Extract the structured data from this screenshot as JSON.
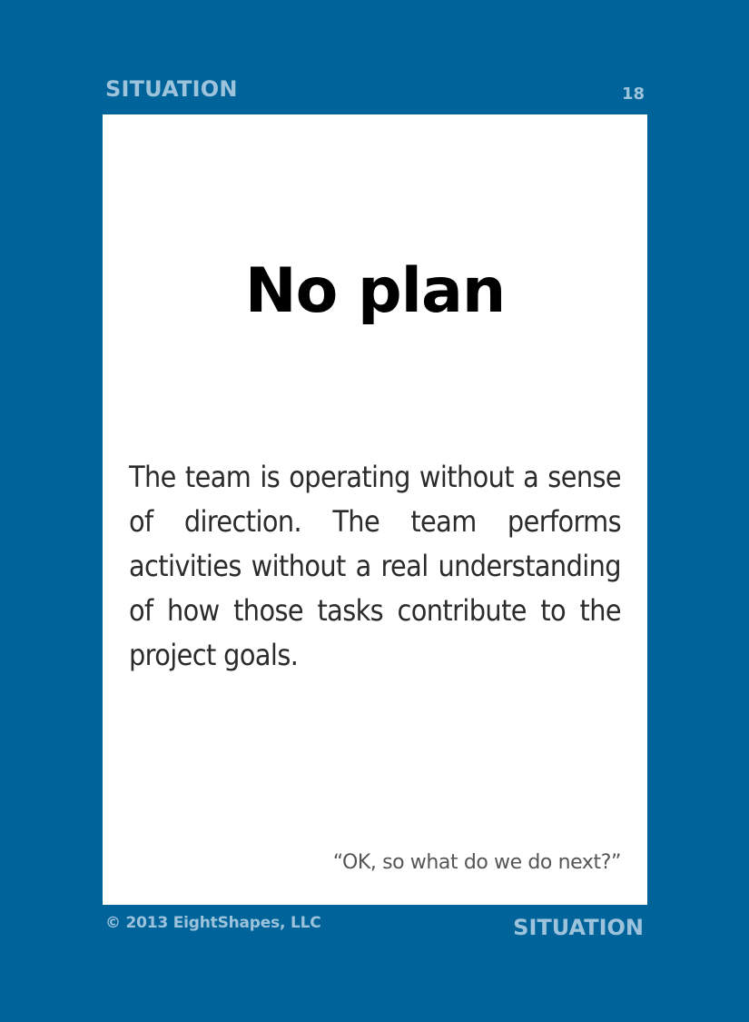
{
  "header": {
    "category": "SITUATION",
    "number": "18"
  },
  "card": {
    "title": "No plan",
    "description": "The team is operating without a sense of direction. The team performs activities without a real understanding of how those tasks contribute to the project goals.",
    "quote": "“OK, so what do we do next?”"
  },
  "footer": {
    "copyright": "© 2013 EightShapes, LLC",
    "category": "SITUATION"
  },
  "colors": {
    "background": "#00649a",
    "label": "#9dc3dc",
    "panel": "#ffffff",
    "title": "#000000",
    "body_text": "#2b2b2b",
    "quote_text": "#555555"
  }
}
